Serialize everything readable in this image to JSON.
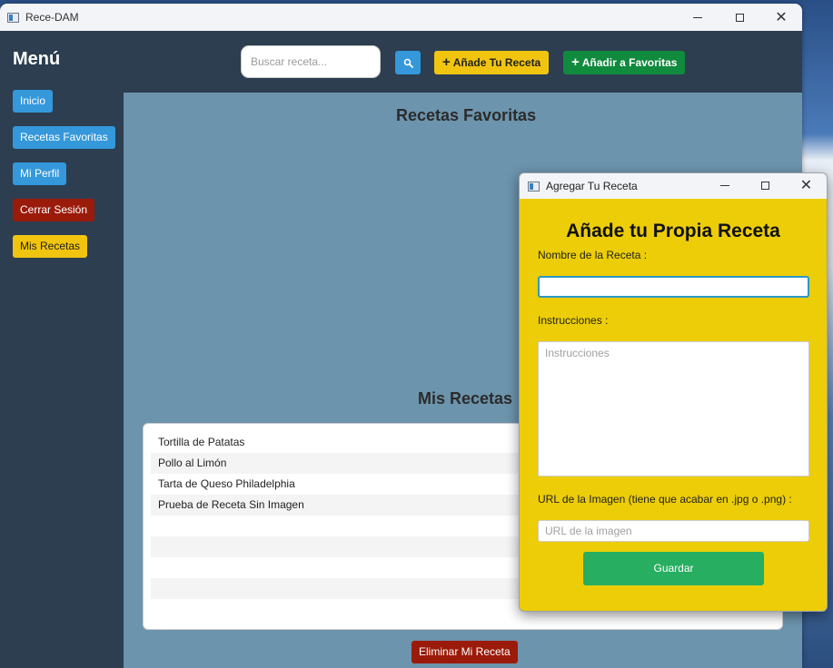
{
  "main_window": {
    "title": "Rece-DAM"
  },
  "sidebar": {
    "title": "Menú",
    "items": [
      {
        "label": "Inicio"
      },
      {
        "label": "Recetas Favoritas"
      },
      {
        "label": "Mi Perfil"
      },
      {
        "label": "Cerrar Sesión"
      },
      {
        "label": "Mis Recetas"
      }
    ]
  },
  "toolbar": {
    "search_placeholder": "Buscar receta...",
    "search_button_icon": "search-icon",
    "add_recipe_label": "Añade Tu Receta",
    "add_favorites_label": "Añadir a Favoritas",
    "plus_glyph": "+"
  },
  "favorites": {
    "title": "Recetas Favoritas"
  },
  "my_recipes": {
    "title": "Mis Recetas",
    "items": [
      "Tortilla de Patatas",
      "Pollo al Limón",
      "Tarta de Queso Philadelphia",
      "Prueba de Receta Sin Imagen"
    ],
    "delete_label": "Eliminar Mi Receta"
  },
  "dialog": {
    "title": "Agregar Tu Receta",
    "heading": "Añade tu Propia Receta",
    "name_label": "Nombre de la Receta :",
    "name_value": "",
    "instructions_label": "Instrucciones :",
    "instructions_placeholder": "Instrucciones",
    "url_label": "URL de la Imagen (tiene que acabar en .jpg o .png) :",
    "url_placeholder": "URL de la imagen",
    "save_label": "Guardar"
  },
  "colors": {
    "sidebar_bg": "#2c3e50",
    "content_bg": "#6c94ad",
    "accent_blue": "#3498db",
    "accent_red": "#9b1b0a",
    "accent_yellow": "#f1c40f",
    "accent_green": "#108a3d",
    "dialog_bg": "#eccd07",
    "save_green": "#27ae60"
  }
}
